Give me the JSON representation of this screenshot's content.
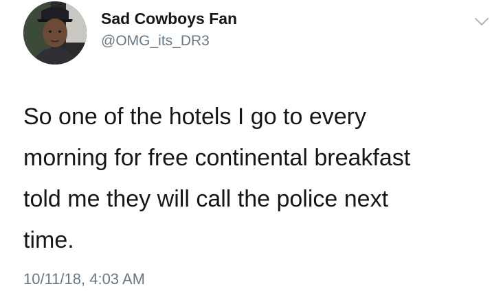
{
  "user": {
    "display_name": "Sad Cowboys Fan",
    "handle": "@OMG_its_DR3",
    "avatar_icon": "profile-photo"
  },
  "tweet": {
    "text_lines": [
      "So one of the hotels I go to every",
      "morning for free continental breakfast",
      "told me they will call the police next",
      "time."
    ],
    "timestamp": "10/11/18, 4:03 AM"
  },
  "menu": {
    "icon": "chevron-down-icon"
  },
  "colors": {
    "primary_text": "#14171a",
    "secondary_text": "#657786",
    "background": "#ffffff"
  }
}
